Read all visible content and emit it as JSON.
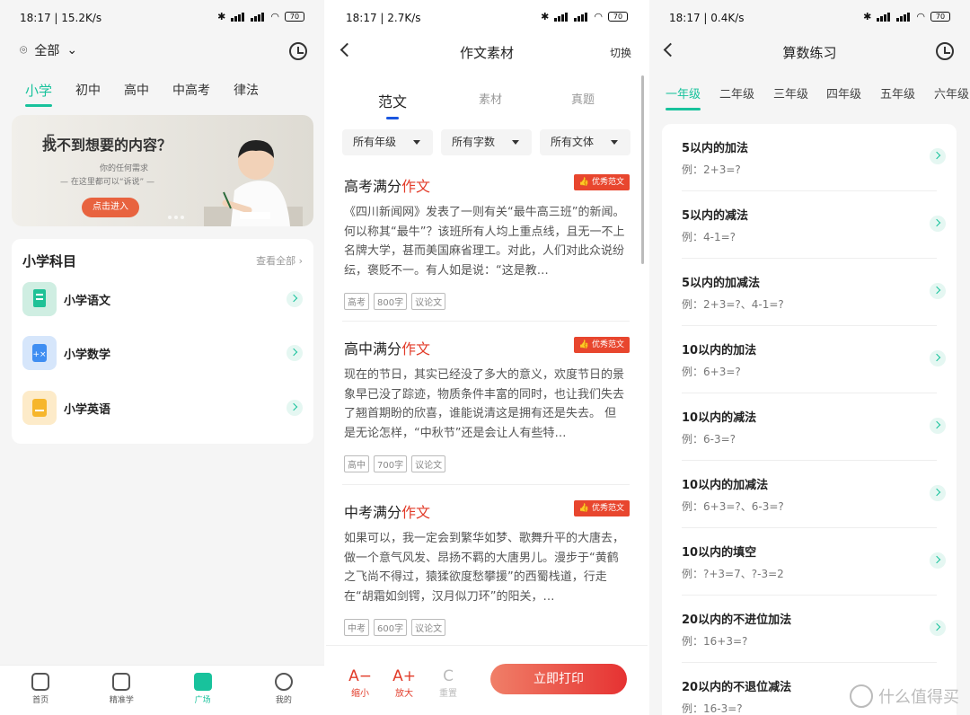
{
  "panel1": {
    "status": {
      "time_speed": "18:17 | 15.2K/s",
      "battery": "70"
    },
    "location_label": "全部",
    "tabs": [
      "小学",
      "初中",
      "高中",
      "中高考",
      "律法"
    ],
    "banner": {
      "title": "找不到想要的内容？",
      "line1": "你的任何需求",
      "line2": "— 在这里都可以“诉说” —",
      "button": "点击进入"
    },
    "section_title": "小学科目",
    "section_more": "查看全部",
    "subjects": [
      {
        "name": "小学语文",
        "color": "#cfeee2"
      },
      {
        "name": "小学数学",
        "color": "#d6e6fb"
      },
      {
        "name": "小学英语",
        "color": "#fdebc9"
      }
    ],
    "nav": [
      "首页",
      "精准学",
      "广场",
      "我的"
    ]
  },
  "panel2": {
    "status": {
      "time_speed": "18:17 | 2.7K/s",
      "battery": "70"
    },
    "title": "作文素材",
    "right_action": "切换",
    "tabs": [
      "范文",
      "素材",
      "真题"
    ],
    "filters": [
      "所有年级",
      "所有字数",
      "所有文体"
    ],
    "badge_label": "优秀范文",
    "articles": [
      {
        "title_a": "高考满分",
        "title_b": "作文",
        "body": "《四川新闻网》发表了一则有关“最牛高三班”的新闻。何以称其“最牛”？该班所有人均上重点线，且无一不上名牌大学，甚而美国麻省理工。对此，人们对此众说纷纭，褒贬不一。有人如是说：“这是教…",
        "tags": [
          "高考",
          "800字",
          "议论文"
        ]
      },
      {
        "title_a": "高中满分",
        "title_b": "作文",
        "body": "现在的节日，其实已经没了多大的意义，欢度节日的景象早已没了踪迹，物质条件丰富的同时，也让我们失去了翘首期盼的欣喜，谁能说清这是拥有还是失去。 但是无论怎样，“中秋节”还是会让人有些特…",
        "tags": [
          "高中",
          "700字",
          "议论文"
        ]
      },
      {
        "title_a": "中考满分",
        "title_b": "作文",
        "body": "如果可以，我一定会到繁华如梦、歌舞升平的大唐去，做一个意气风发、昂扬不羁的大唐男儿。漫步于“黄鹤之飞尚不得过，猿猱欲度愁攀援”的西蜀栈道，行走在“胡霜如剑锷，汉月似刀环”的阳关，…",
        "tags": [
          "中考",
          "600字",
          "议论文"
        ]
      }
    ],
    "bottom": {
      "shrink_icon": "A−",
      "shrink": "缩小",
      "enlarge_icon": "A+",
      "enlarge": "放大",
      "reset_icon": "C",
      "reset": "重置",
      "print": "立即打印"
    }
  },
  "panel3": {
    "status": {
      "time_speed": "18:17 | 0.4K/s",
      "battery": "70"
    },
    "title": "算数练习",
    "grades": [
      "一年级",
      "二年级",
      "三年级",
      "四年级",
      "五年级",
      "六年级"
    ],
    "items": [
      {
        "title": "5以内的加法",
        "example": "例：2+3=?"
      },
      {
        "title": "5以内的减法",
        "example": "例：4-1=?"
      },
      {
        "title": "5以内的加减法",
        "example": "例：2+3=?、4-1=?"
      },
      {
        "title": "10以内的加法",
        "example": "例：6+3=?"
      },
      {
        "title": "10以内的减法",
        "example": "例：6-3=?"
      },
      {
        "title": "10以内的加减法",
        "example": "例：6+3=?、6-3=?"
      },
      {
        "title": "10以内的填空",
        "example": "例：?+3=7、?-3=2"
      },
      {
        "title": "20以内的不进位加法",
        "example": "例：16+3=?"
      },
      {
        "title": "20以内的不退位减法",
        "example": "例：16-3=?"
      }
    ],
    "watermark": "什么值得买"
  },
  "colors": {
    "accent_green": "#18c29c",
    "accent_red": "#e23c2a",
    "tab_blue": "#1a56e0"
  }
}
